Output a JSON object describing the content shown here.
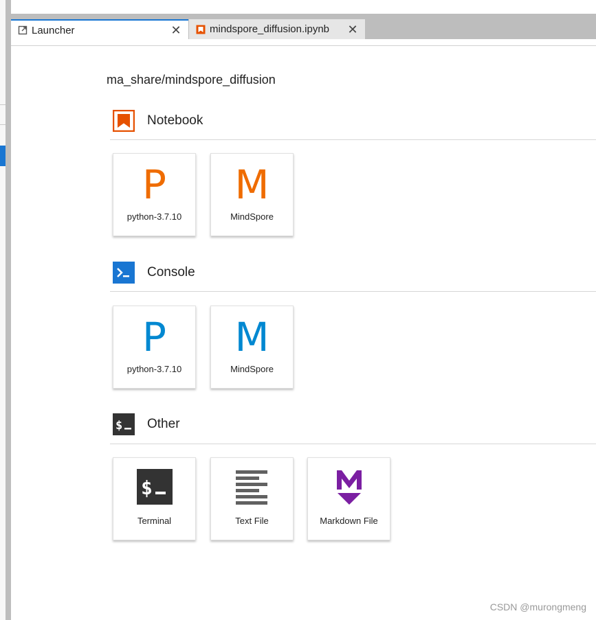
{
  "tabs": [
    {
      "label": "Launcher",
      "icon": "launcher-icon",
      "active": true
    },
    {
      "label": "mindspore_diffusion.ipynb",
      "icon": "notebook-icon",
      "active": false
    }
  ],
  "close_glyph": "✕",
  "path": "ma_share/mindspore_diffusion",
  "sections": {
    "notebook": {
      "title": "Notebook",
      "color": "#e65100",
      "cards": [
        {
          "letter": "P",
          "label": "python-3.7.10"
        },
        {
          "letter": "M",
          "label": "MindSpore"
        }
      ]
    },
    "console": {
      "title": "Console",
      "color": "#1976d2",
      "cards": [
        {
          "letter": "P",
          "label": "python-3.7.10"
        },
        {
          "letter": "M",
          "label": "MindSpore"
        }
      ]
    },
    "other": {
      "title": "Other",
      "color": "#333333",
      "cards": [
        {
          "label": "Terminal",
          "icon": "terminal-icon"
        },
        {
          "label": "Text File",
          "icon": "text-file-icon"
        },
        {
          "label": "Markdown File",
          "icon": "markdown-icon"
        }
      ]
    }
  },
  "colors": {
    "notebook_letter": "#ef6c00",
    "console_letter": "#0288d1",
    "markdown": "#7b1fa2",
    "accent": "#1976d2"
  },
  "watermark": "CSDN @murongmeng"
}
